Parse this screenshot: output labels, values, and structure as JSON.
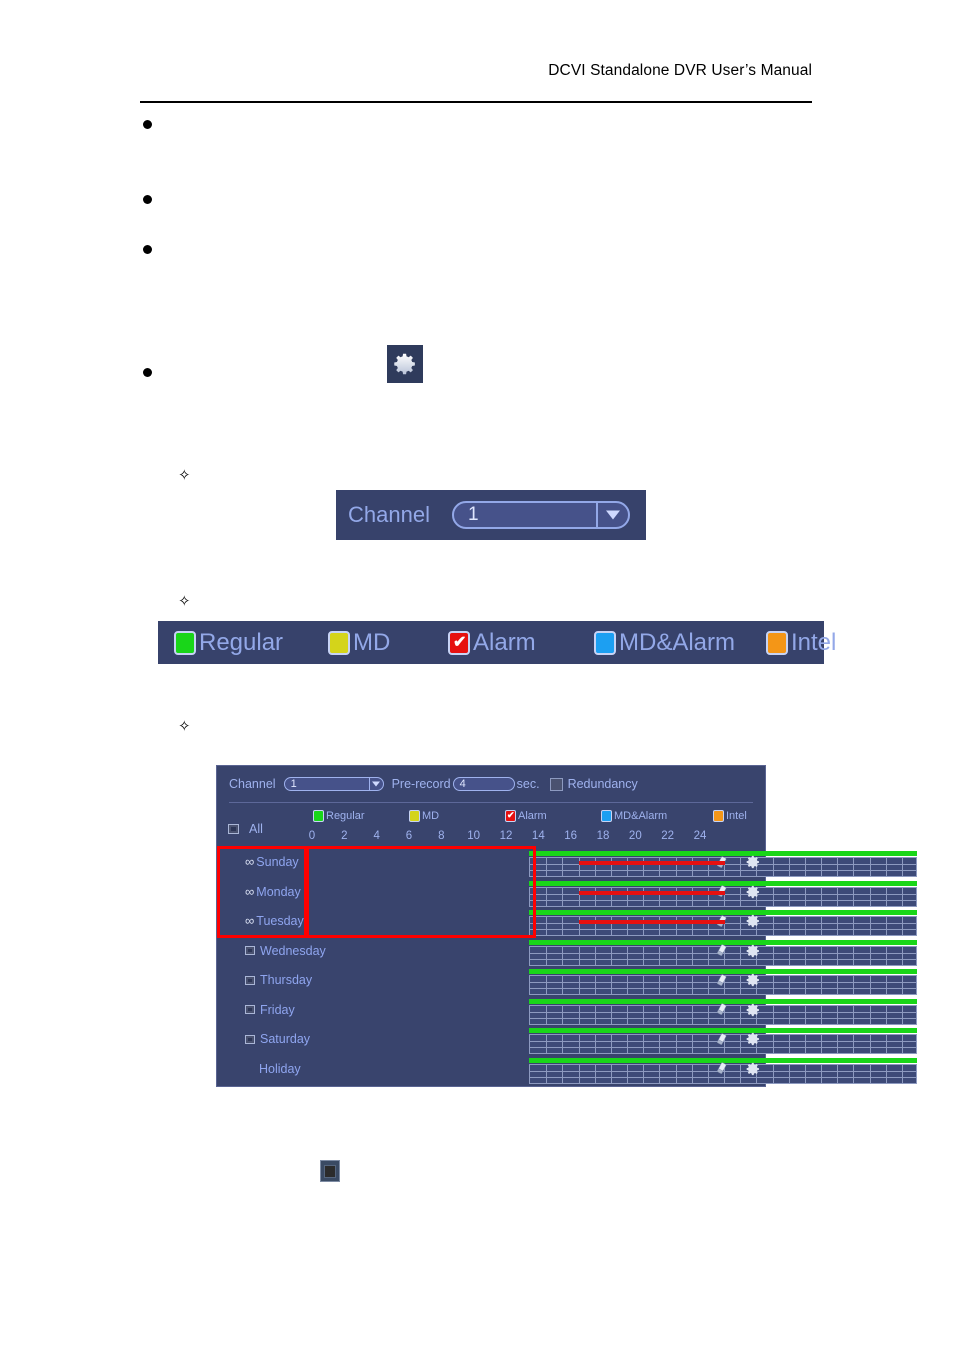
{
  "page": {
    "header_title": "DCVI Standalone DVR User’s Manual"
  },
  "body_bullets": [
    {
      "marker": "●",
      "text": ""
    },
    {
      "marker": "●",
      "text": ""
    },
    {
      "marker": "●",
      "text": ""
    },
    {
      "marker": "●",
      "text": ""
    }
  ],
  "diamond_bullets": [
    {
      "marker": "✧",
      "text": ""
    },
    {
      "marker": "✧",
      "text": ""
    },
    {
      "marker": "✧",
      "text": ""
    }
  ],
  "inline_icons": {
    "gear_name": "gear-icon",
    "square_button_name": "square-button-icon"
  },
  "channel_figure": {
    "label": "Channel",
    "value": "1",
    "dropdown_icon": "chevron-down-icon"
  },
  "legend_figure": {
    "items": [
      {
        "label": "Regular",
        "color": "#19d619",
        "checked": false
      },
      {
        "label": "MD",
        "color": "#d4d41a",
        "checked": false
      },
      {
        "label": "Alarm",
        "color": "#e61010",
        "checked": true
      },
      {
        "label": "MD&Alarm",
        "color": "#1c9ff2",
        "checked": false
      },
      {
        "label": "Intel",
        "color": "#f49617",
        "checked": false
      }
    ]
  },
  "schedule_panel": {
    "channel_label": "Channel",
    "channel_value": "1",
    "prerecord_label": "Pre-record",
    "prerecord_value": "4",
    "prerecord_unit": "sec.",
    "redundancy_label": "Redundancy",
    "redundancy_checked": false,
    "all_label": "All",
    "all_checked": false,
    "legend": [
      {
        "label": "Regular",
        "color": "#19d619",
        "checked": false
      },
      {
        "label": "MD",
        "color": "#d4d41a",
        "checked": false
      },
      {
        "label": "Alarm",
        "color": "#e61010",
        "checked": true
      },
      {
        "label": "MD&Alarm",
        "color": "#1c9ff2",
        "checked": false
      },
      {
        "label": "Intel",
        "color": "#f49617",
        "checked": false
      }
    ],
    "axis_ticks": [
      "0",
      "2",
      "4",
      "6",
      "8",
      "10",
      "12",
      "14",
      "16",
      "18",
      "20",
      "22",
      "24"
    ],
    "rows": [
      {
        "label": "Sunday",
        "icon": "chain-link-icon",
        "checkbox": false,
        "green_start": 0,
        "green_end": 24,
        "red_start": 3.1,
        "red_end": 12.1
      },
      {
        "label": "Monday",
        "icon": "chain-link-icon",
        "checkbox": false,
        "green_start": 0,
        "green_end": 24,
        "red_start": 3.1,
        "red_end": 12.1
      },
      {
        "label": "Tuesday",
        "icon": "chain-link-icon",
        "checkbox": false,
        "green_start": 0,
        "green_end": 24,
        "red_start": 3.1,
        "red_end": 12.1
      },
      {
        "label": "Wednesday",
        "icon": "checkbox-icon",
        "checkbox": true,
        "green_start": 0,
        "green_end": 24,
        "red_start": null,
        "red_end": null
      },
      {
        "label": "Thursday",
        "icon": "checkbox-icon",
        "checkbox": true,
        "green_start": 0,
        "green_end": 24,
        "red_start": null,
        "red_end": null
      },
      {
        "label": "Friday",
        "icon": "checkbox-icon",
        "checkbox": true,
        "green_start": 0,
        "green_end": 24,
        "red_start": null,
        "red_end": null
      },
      {
        "label": "Saturday",
        "icon": "checkbox-icon",
        "checkbox": true,
        "green_start": 0,
        "green_end": 24,
        "red_start": null,
        "red_end": null
      },
      {
        "label": "Holiday",
        "icon": "none",
        "checkbox": false,
        "green_start": 0,
        "green_end": 24,
        "red_start": null,
        "red_end": null
      }
    ],
    "row_action_icons": [
      "eraser-icon",
      "gear-icon"
    ],
    "annotation_color": "#ff0000"
  }
}
